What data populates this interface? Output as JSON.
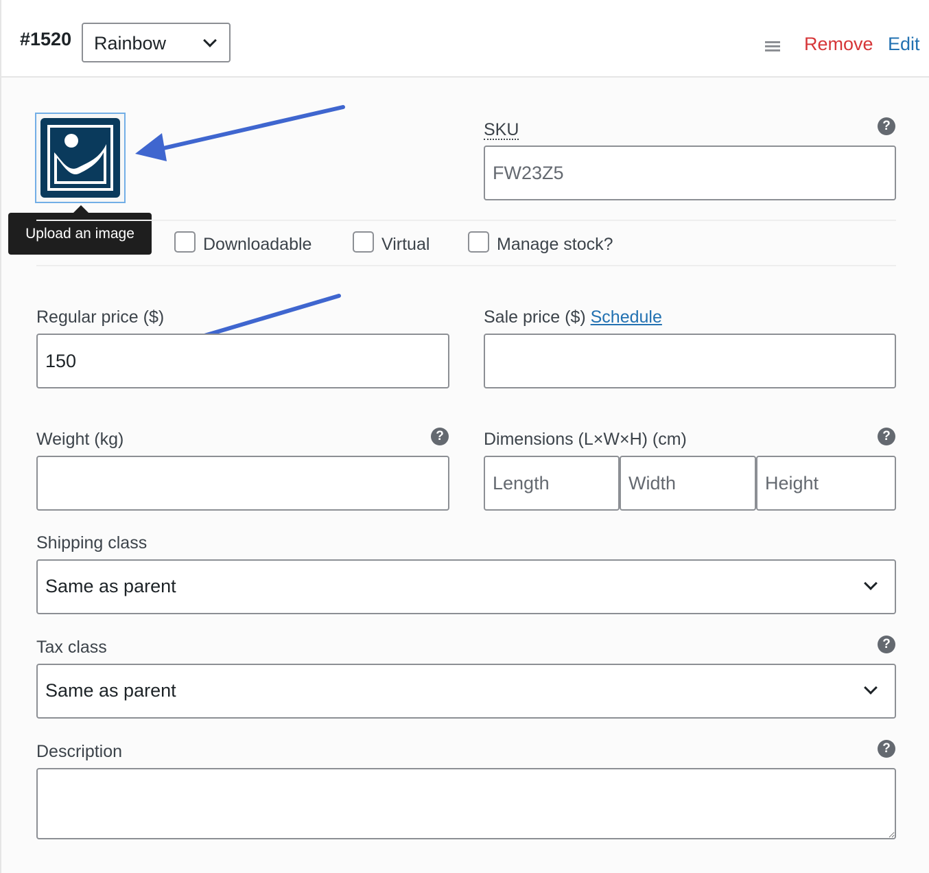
{
  "variation": {
    "id": "#1520",
    "attribute_value": "Rainbow"
  },
  "header_actions": {
    "remove_label": "Remove",
    "edit_label": "Edit"
  },
  "image": {
    "tooltip": "Upload an image"
  },
  "sku": {
    "label": "SKU",
    "placeholder": "FW23Z5"
  },
  "options": {
    "downloadable_label": "Downloadable",
    "virtual_label": "Virtual",
    "manage_stock_label": "Manage stock?"
  },
  "regular_price": {
    "label": "Regular price ($)",
    "value": "150"
  },
  "sale_price": {
    "label": "Sale price ($)",
    "schedule_label": "Schedule",
    "value": ""
  },
  "weight": {
    "label": "Weight (kg)",
    "value": ""
  },
  "dimensions": {
    "label": "Dimensions (L×W×H) (cm)",
    "length_placeholder": "Length",
    "width_placeholder": "Width",
    "height_placeholder": "Height"
  },
  "shipping_class": {
    "label": "Shipping class",
    "selected": "Same as parent"
  },
  "tax_class": {
    "label": "Tax class",
    "selected": "Same as parent"
  },
  "description": {
    "label": "Description",
    "value": ""
  },
  "colors": {
    "remove": "#d63638",
    "link": "#2271b1",
    "arrow": "#3f66cf",
    "image_icon": "#0a3a5c"
  },
  "icons": [
    "chevron-down-icon",
    "drag-handle-icon",
    "help-icon",
    "image-placeholder-icon",
    "arrow-annotation"
  ]
}
